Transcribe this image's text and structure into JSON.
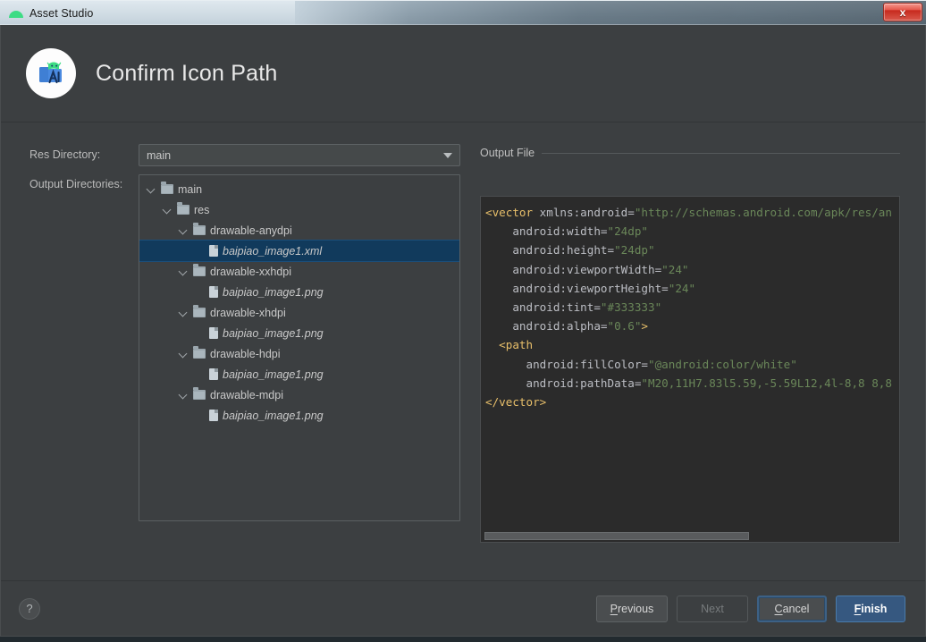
{
  "window": {
    "titlebar_text": "Asset Studio",
    "titlebar_icon": "android-head-icon",
    "close_label": "x"
  },
  "header": {
    "title": "Confirm Icon Path",
    "icon": "asset-studio-icon"
  },
  "form": {
    "res_directory_label": "Res Directory:",
    "res_directory_value": "main",
    "output_directories_label": "Output Directories:"
  },
  "tree": {
    "nodes": [
      {
        "label": "main",
        "indent": 0,
        "type": "folder",
        "expanded": true,
        "selected": false,
        "italic": false
      },
      {
        "label": "res",
        "indent": 1,
        "type": "folder",
        "expanded": true,
        "selected": false,
        "italic": false
      },
      {
        "label": "drawable-anydpi",
        "indent": 2,
        "type": "folder",
        "expanded": true,
        "selected": false,
        "italic": false
      },
      {
        "label": "baipiao_image1.xml",
        "indent": 3,
        "type": "file",
        "expanded": false,
        "selected": true,
        "italic": true
      },
      {
        "label": "drawable-xxhdpi",
        "indent": 2,
        "type": "folder",
        "expanded": true,
        "selected": false,
        "italic": false
      },
      {
        "label": "baipiao_image1.png",
        "indent": 3,
        "type": "file",
        "expanded": false,
        "selected": false,
        "italic": true
      },
      {
        "label": "drawable-xhdpi",
        "indent": 2,
        "type": "folder",
        "expanded": true,
        "selected": false,
        "italic": false
      },
      {
        "label": "baipiao_image1.png",
        "indent": 3,
        "type": "file",
        "expanded": false,
        "selected": false,
        "italic": true
      },
      {
        "label": "drawable-hdpi",
        "indent": 2,
        "type": "folder",
        "expanded": true,
        "selected": false,
        "italic": false
      },
      {
        "label": "baipiao_image1.png",
        "indent": 3,
        "type": "file",
        "expanded": false,
        "selected": false,
        "italic": true
      },
      {
        "label": "drawable-mdpi",
        "indent": 2,
        "type": "folder",
        "expanded": true,
        "selected": false,
        "italic": false
      },
      {
        "label": "baipiao_image1.png",
        "indent": 3,
        "type": "file",
        "expanded": false,
        "selected": false,
        "italic": true
      }
    ]
  },
  "output_file": {
    "group_label": "Output File",
    "code_lines": [
      [
        {
          "t": "tag",
          "v": "<vector "
        },
        {
          "t": "attr",
          "v": "xmlns:android="
        },
        {
          "t": "str",
          "v": "\"http://schemas.android.com/apk/res/an"
        }
      ],
      [
        {
          "t": "plain",
          "v": "    "
        },
        {
          "t": "attr",
          "v": "android:width="
        },
        {
          "t": "str",
          "v": "\"24dp\""
        }
      ],
      [
        {
          "t": "plain",
          "v": "    "
        },
        {
          "t": "attr",
          "v": "android:height="
        },
        {
          "t": "str",
          "v": "\"24dp\""
        }
      ],
      [
        {
          "t": "plain",
          "v": "    "
        },
        {
          "t": "attr",
          "v": "android:viewportWidth="
        },
        {
          "t": "str",
          "v": "\"24\""
        }
      ],
      [
        {
          "t": "plain",
          "v": "    "
        },
        {
          "t": "attr",
          "v": "android:viewportHeight="
        },
        {
          "t": "str",
          "v": "\"24\""
        }
      ],
      [
        {
          "t": "plain",
          "v": "    "
        },
        {
          "t": "attr",
          "v": "android:tint="
        },
        {
          "t": "str",
          "v": "\"#333333\""
        }
      ],
      [
        {
          "t": "plain",
          "v": "    "
        },
        {
          "t": "attr",
          "v": "android:alpha="
        },
        {
          "t": "str",
          "v": "\"0.6\""
        },
        {
          "t": "tag",
          "v": ">"
        }
      ],
      [
        {
          "t": "plain",
          "v": "  "
        },
        {
          "t": "tag",
          "v": "<path"
        }
      ],
      [
        {
          "t": "plain",
          "v": "      "
        },
        {
          "t": "attr",
          "v": "android:fillColor="
        },
        {
          "t": "str",
          "v": "\"@android:color/white\""
        }
      ],
      [
        {
          "t": "plain",
          "v": "      "
        },
        {
          "t": "attr",
          "v": "android:pathData="
        },
        {
          "t": "str",
          "v": "\"M20,11H7.83l5.59,-5.59L12,4l-8,8 8,8"
        }
      ],
      [
        {
          "t": "tag",
          "v": "</vector>"
        }
      ]
    ]
  },
  "footer": {
    "help_label": "?",
    "buttons": [
      {
        "label": "Previous",
        "mnemonic": "P",
        "state": "enabled"
      },
      {
        "label": "Next",
        "mnemonic": "N",
        "state": "disabled"
      },
      {
        "label": "Cancel",
        "mnemonic": "C",
        "state": "focused"
      },
      {
        "label": "Finish",
        "mnemonic": "F",
        "state": "default"
      }
    ]
  },
  "colors": {
    "dialog_bg": "#3c3f41",
    "code_bg": "#2b2b2b",
    "selection_blue": "#113a5c",
    "primary_button": "#365880",
    "accent_green": "#3ddc84",
    "string_green": "#6a8759",
    "tag_gold": "#e8bf6a"
  }
}
